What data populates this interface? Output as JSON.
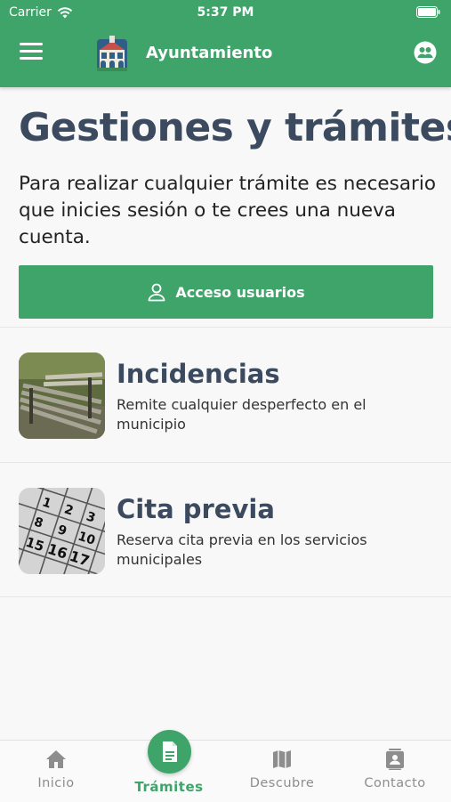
{
  "status_bar": {
    "carrier": "Carrier",
    "time": "5:37 PM"
  },
  "header": {
    "title": "Ayuntamiento"
  },
  "main": {
    "title": "Gestiones y trámites",
    "intro": "Para realizar cualquier trámite es necesario que inicies sesión o te crees una nueva cuenta.",
    "access_button_label": "Acceso usuarios",
    "cards": [
      {
        "title": "Incidencias",
        "description": "Remite cualquier desperfecto en el municipio"
      },
      {
        "title": "Cita previa",
        "description": "Reserva cita previa en los servicios municipales"
      }
    ]
  },
  "tabbar": {
    "tabs": [
      {
        "label": "Inicio",
        "icon": "home-icon"
      },
      {
        "label": "Trámites",
        "icon": "document-icon",
        "active": true
      },
      {
        "label": "Descubre",
        "icon": "map-icon"
      },
      {
        "label": "Contacto",
        "icon": "contact-book-icon"
      }
    ]
  },
  "colors": {
    "primary": "#3fa46a",
    "title": "#3b4a5e",
    "background": "#f8f8f8",
    "inactive_tab": "#8d8d8d"
  }
}
